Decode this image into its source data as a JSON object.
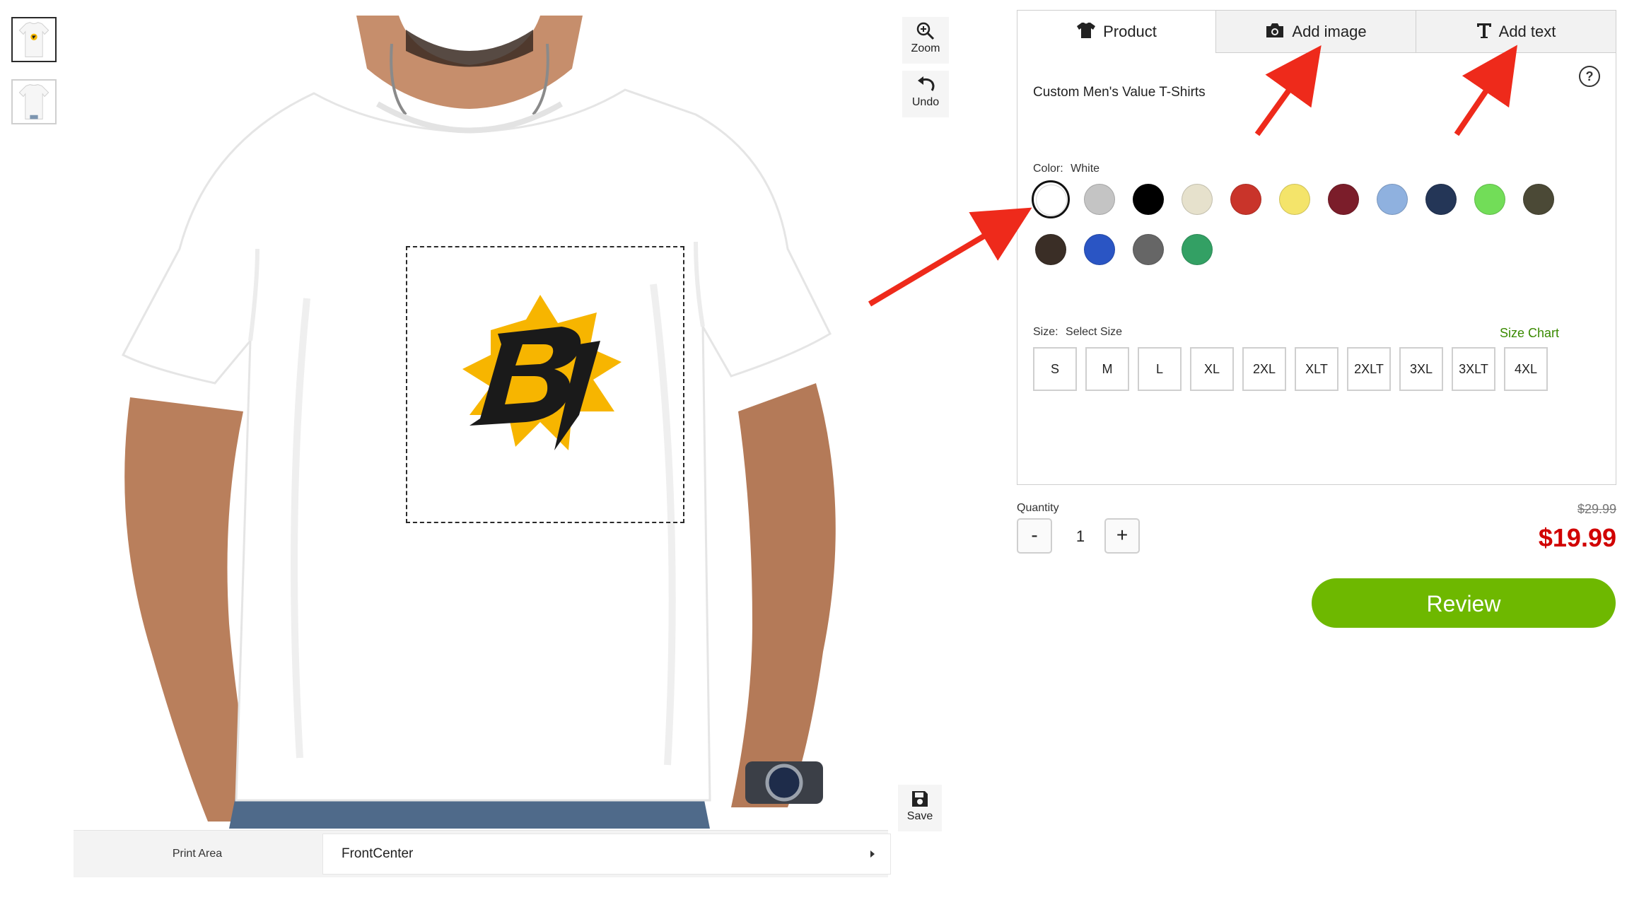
{
  "thumbnails": [
    {
      "label": "front-thumbnail",
      "active": true
    },
    {
      "label": "back-thumbnail",
      "active": false
    }
  ],
  "tools": {
    "zoom_label": "Zoom",
    "undo_label": "Undo",
    "save_label": "Save"
  },
  "print_area": {
    "label": "Print Area",
    "selected": "FrontCenter"
  },
  "tabs": {
    "product": "Product",
    "add_image": "Add image",
    "add_text": "Add text"
  },
  "help_glyph": "?",
  "product_name": "Custom Men's Value T-Shirts",
  "color": {
    "label": "Color:",
    "selected_name": "White",
    "swatches": [
      "#ffffff",
      "#c4c4c4",
      "#000000",
      "#e6e1cc",
      "#c9342a",
      "#f4e46a",
      "#7b1d2a",
      "#8fb1df",
      "#243657",
      "#72dd58",
      "#4b4936",
      "#3a2e26",
      "#2a55c4",
      "#666666",
      "#33a064"
    ]
  },
  "size": {
    "label": "Size:",
    "selected_text": "Select Size",
    "chart_link": "Size Chart",
    "options": [
      "S",
      "M",
      "L",
      "XL",
      "2XL",
      "XLT",
      "2XLT",
      "3XL",
      "3XLT",
      "4XL"
    ]
  },
  "quantity": {
    "label": "Quantity",
    "minus": "-",
    "plus": "+",
    "value": "1"
  },
  "price": {
    "original": "$29.99",
    "sale": "$19.99"
  },
  "review_label": "Review",
  "colors": {
    "accent_green": "#6eb800",
    "price_red": "#d10000",
    "size_chart_green": "#3a8a00",
    "arrow_red": "#ee2a1b"
  }
}
